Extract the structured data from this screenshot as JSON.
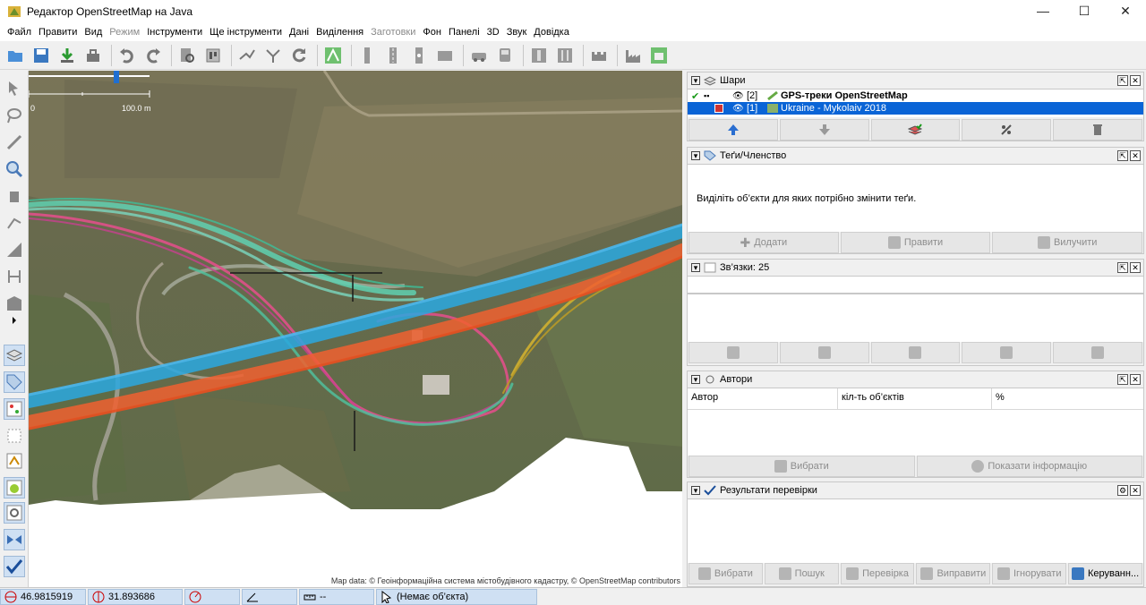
{
  "window": {
    "title": "Редактор OpenStreetMap на Java",
    "minimize": "—",
    "maximize": "☐",
    "close": "✕"
  },
  "menu": [
    {
      "label": "Файл",
      "enabled": true
    },
    {
      "label": "Правити",
      "enabled": true
    },
    {
      "label": "Вид",
      "enabled": true
    },
    {
      "label": "Режим",
      "enabled": false
    },
    {
      "label": "Інструменти",
      "enabled": true
    },
    {
      "label": "Ще інструменти",
      "enabled": true
    },
    {
      "label": "Дані",
      "enabled": true
    },
    {
      "label": "Виділення",
      "enabled": true
    },
    {
      "label": "Заготовки",
      "enabled": false
    },
    {
      "label": "Фон",
      "enabled": true
    },
    {
      "label": "Панелі",
      "enabled": true
    },
    {
      "label": "3D",
      "enabled": true
    },
    {
      "label": "Звук",
      "enabled": true
    },
    {
      "label": "Довідка",
      "enabled": true
    }
  ],
  "map": {
    "scale_start": "0",
    "scale_end": "100.0 m",
    "attribution": "Map data: © Геоінформаційна система містобудівного кадастру, © OpenStreetMap contributors"
  },
  "layers_panel": {
    "title": "Шари",
    "layers": [
      {
        "index": "[2]",
        "name": "GPS-треки OpenStreetMap",
        "selected": false
      },
      {
        "index": "[1]",
        "name": "Ukraine - Mykolaiv 2018",
        "selected": true
      }
    ]
  },
  "tags_panel": {
    "title": "Теґи/Членство",
    "message": "Виділіть об’єкти для яких потрібно змінити теґи.",
    "add_label": "Додати",
    "edit_label": "Правити",
    "delete_label": "Вилучити"
  },
  "relations_panel": {
    "title": "Зв’язки: 25"
  },
  "authors_panel": {
    "title": "Автори",
    "columns": [
      "Автор",
      "кіл-ть об’єктів",
      "%"
    ],
    "select_label": "Вибрати",
    "info_label": "Показати інформацію"
  },
  "validation_panel": {
    "title": "Результати перевірки",
    "buttons": [
      "Вибрати",
      "Пошук",
      "Перевірка",
      "Виправити",
      "Ігнорувати",
      "Керуванн..."
    ]
  },
  "status": {
    "lat": "46.9815919",
    "lon": "31.893686",
    "heading": "",
    "angle": "",
    "length": "--",
    "selection": "(Немає об’єкта)"
  },
  "colors": {
    "selection_blue": "#0a64d6",
    "track_blue": "#2aa8e0",
    "track_orange": "#f06030",
    "track_teal": "#5fd0b0",
    "track_pink": "#e0508a",
    "track_yellow": "#d0b030"
  }
}
